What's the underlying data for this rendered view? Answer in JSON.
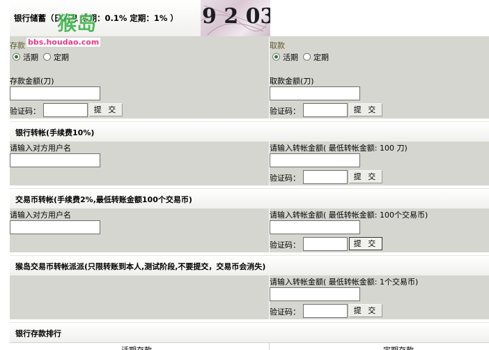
{
  "header": {
    "title": "银行储蓄（日利息 活期：0.1% 定期：1% ）",
    "captcha_text": "9 2 03"
  },
  "watermark": {
    "main": "猴岛",
    "url": "bbs.houdao.com"
  },
  "deposit": {
    "title": "存款",
    "option_current": "活期",
    "option_fixed": "定期",
    "amount_label": "存款金额(刀)",
    "amount_value": "",
    "captcha_label": "验证码：",
    "captcha_value": "",
    "submit_label": "提 交"
  },
  "withdraw": {
    "title": "取款",
    "option_current": "活期",
    "option_fixed": "定期",
    "amount_label": "取款金额(刀)",
    "amount_value": "",
    "captcha_label": "验证码：",
    "captcha_value": "",
    "submit_label": "提 交"
  },
  "bank_transfer": {
    "title": "银行转帐(手续费10%)",
    "recipient_label": "请输入对方用户名",
    "amount_label": "请输入转帐金额( 最低转帐金额: 100 刀)",
    "captcha_label": "验证码：",
    "submit_label": "提 交"
  },
  "coin_transfer": {
    "title": "交易币转帐(手续费2%,最低转账金额100个交易币)",
    "recipient_label": "请输入对方用户名",
    "amount_label": "请输入转帐金额( 最低转帐金额: 100个交易币)",
    "captcha_label": "验证码：",
    "submit_label": "提 交"
  },
  "monkey_transfer": {
    "title": "猴岛交易币转帐派派(只限转账到本人,测试阶段,不要提交，交易币会消失)",
    "amount_label": "请输入转帐金额( 最低转帐金额: 1个交易币)",
    "captcha_label": "验证码：",
    "submit_label": "提 交"
  },
  "ranking": {
    "title": "银行存款排行",
    "col_current": "活期存款",
    "col_fixed": "定期存款"
  },
  "colors": {
    "panel": "#d6d6d0",
    "radio_selected": "#2a7a2a",
    "watermark": "#3fb34a",
    "watermark_url": "#e23b8a"
  }
}
